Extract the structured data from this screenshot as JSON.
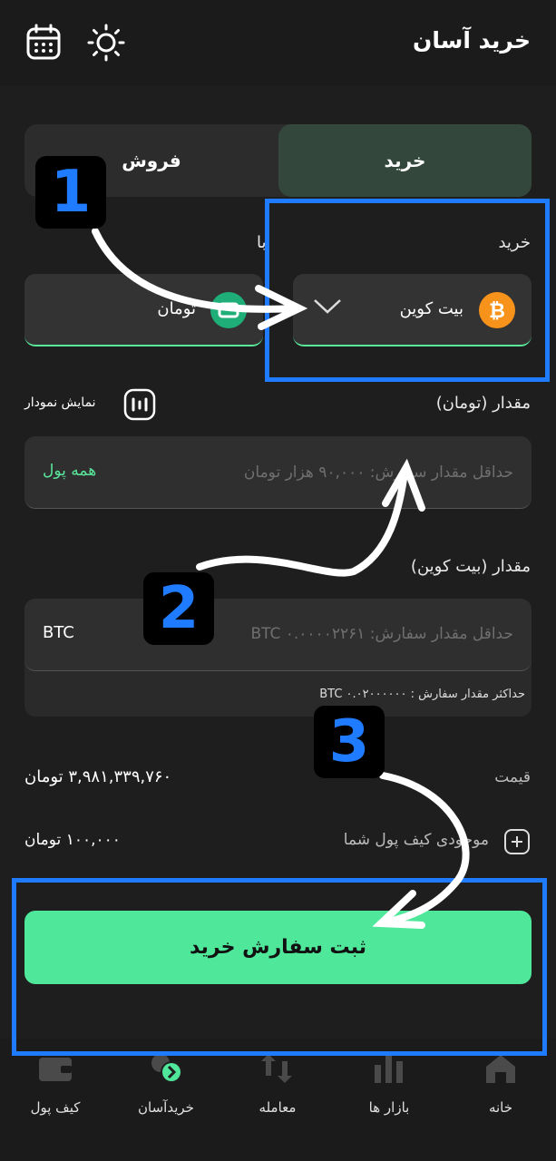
{
  "header": {
    "title": "خرید آسان",
    "calendar_icon": "calendar-icon",
    "theme_icon": "sun-icon"
  },
  "tabs": {
    "buy": "خرید",
    "sell": "فروش"
  },
  "buy_section": {
    "label": "خرید",
    "asset": "بیت کوین",
    "asset_icon": "bitcoin-icon"
  },
  "with_section": {
    "label": "با",
    "asset": "تومان",
    "asset_icon": "toman-icon"
  },
  "chart_toggle": {
    "label": "نمایش نمودار"
  },
  "amount_toman": {
    "label": "مقدار (تومان)",
    "placeholder": "حداقل مقدار سفارش: ۹۰,۰۰۰ هزار تومان",
    "all_wallet": "همه پول"
  },
  "amount_btc": {
    "label": "مقدار (بیت کوین)",
    "placeholder": "حداقل مقدار سفارش: BTC ۰.۰۰۰۰۲۲۶۱",
    "unit": "BTC",
    "max_note": "حداکثر مقدار سفارش : BTC ۰.۰۲۰۰۰۰۰۰"
  },
  "price": {
    "label": "قیمت",
    "value": "۳,۹۸۱,۳۳۹,۷۶۰ تومان"
  },
  "balance": {
    "label": "موجودی کیف پول شما",
    "value": "۱۰۰,۰۰۰ تومان"
  },
  "submit": {
    "label": "ثبت سفارش خرید"
  },
  "annotations": {
    "step1": "1",
    "step2": "2",
    "step3": "3"
  },
  "nav": [
    {
      "label": "خانه",
      "icon": "home-icon"
    },
    {
      "label": "بازار ها",
      "icon": "market-icon"
    },
    {
      "label": "معامله",
      "icon": "trade-icon"
    },
    {
      "label": "خریدآسان",
      "icon": "easy-buy-icon",
      "active": true
    },
    {
      "label": "کیف پول",
      "icon": "wallet-icon"
    }
  ],
  "colors": {
    "accent": "#4fe89b",
    "annotation_blue": "#1f7bff",
    "bitcoin": "#f7931a"
  }
}
